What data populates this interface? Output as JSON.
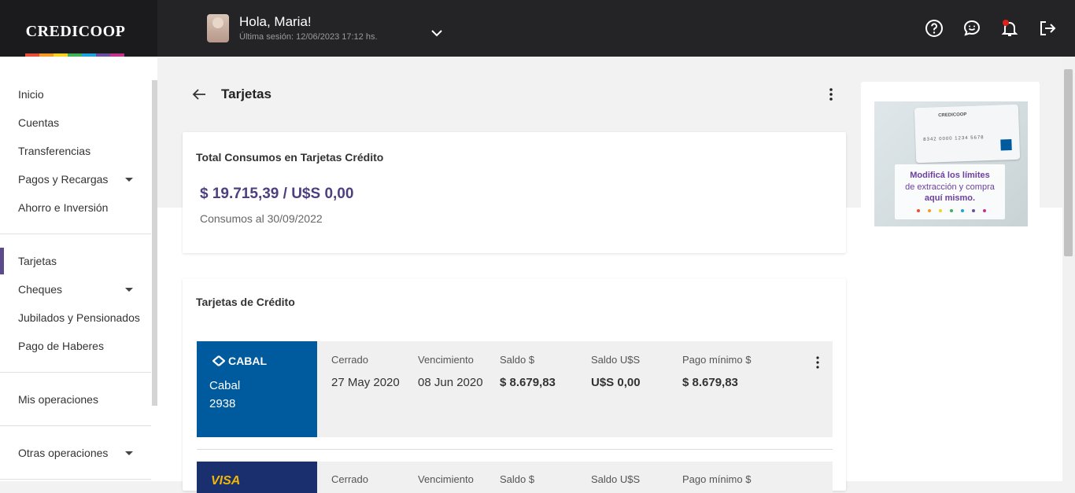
{
  "brand": {
    "name": "CREDICOOP",
    "rainbow_colors": [
      "#e94e3c",
      "#f39c23",
      "#f7d21f",
      "#43b05c",
      "#1fa3dd",
      "#6c4fa0",
      "#c2338c"
    ]
  },
  "header": {
    "greeting": "Hola, Maria!",
    "last_session": "Última sesión: 12/06/2023 17:12 hs.",
    "icons": [
      "help-icon",
      "chat-icon",
      "notification-bell-icon",
      "logout-icon"
    ]
  },
  "sidebar": {
    "items": [
      {
        "label": "Inicio"
      },
      {
        "label": "Cuentas"
      },
      {
        "label": "Transferencias"
      },
      {
        "label": "Pagos y Recargas"
      },
      {
        "label": "Ahorro e Inversión"
      },
      {
        "label": "Tarjetas"
      },
      {
        "label": "Cheques"
      },
      {
        "label": "Jubilados y Pensionados"
      },
      {
        "label": "Pago de Haberes"
      },
      {
        "label": "Mis operaciones"
      },
      {
        "label": "Otras operaciones"
      }
    ],
    "active": "Tarjetas"
  },
  "page": {
    "title": "Tarjetas"
  },
  "summary": {
    "title": "Total Consumos en Tarjetas Crédito",
    "amount": "$ 19.715,39  / U$S 0,00",
    "subtitle": "Consumos al 30/09/2022"
  },
  "credit_cards": {
    "title": "Tarjetas de Crédito",
    "columns": [
      "Cerrado",
      "Vencimiento",
      "Saldo $",
      "Saldo U$S",
      "Pago mínimo $"
    ],
    "rows": [
      {
        "brand": "CABAL",
        "name": "Cabal",
        "number": "2938",
        "values": [
          "27 May 2020",
          "08 Jun 2020",
          "$ 8.679,83",
          "U$S 0,00",
          "$ 8.679,83"
        ]
      },
      {
        "brand": "VISA"
      }
    ]
  },
  "promo": {
    "card_bank": "CREDICOOP",
    "card_number": "8342 0000 1234 5678",
    "line1": "Modificá los límites",
    "line2": "de extracción y compra",
    "line3": "aquí mismo."
  }
}
